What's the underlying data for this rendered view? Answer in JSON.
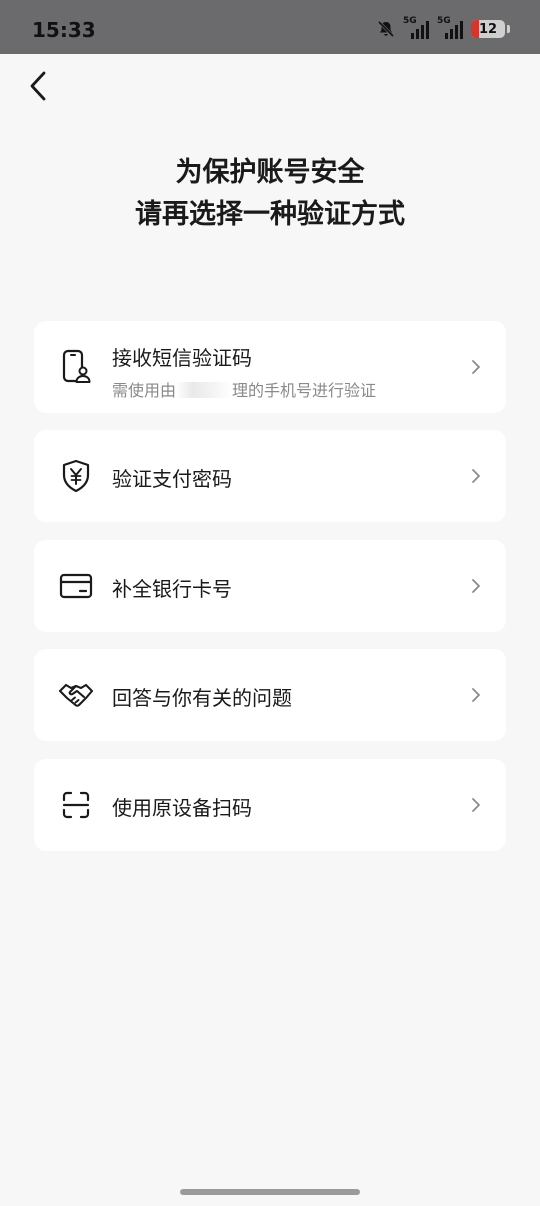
{
  "status_bar": {
    "time": "15:33",
    "signal_1_label": "5G",
    "signal_2_label": "5G",
    "battery_level": "12"
  },
  "header": {
    "back_icon": "chevron-left-icon"
  },
  "title": {
    "line1": "为保护账号安全",
    "line2": "请再选择一种验证方式"
  },
  "options": [
    {
      "icon": "phone-user-icon",
      "label": "接收短信验证码",
      "sub": "需使用由",
      "sub_tail": "理的手机号进行验证"
    },
    {
      "icon": "yuan-shield-icon",
      "label": "验证支付密码"
    },
    {
      "icon": "bank-card-icon",
      "label": "补全银行卡号"
    },
    {
      "icon": "handshake-icon",
      "label": "回答与你有关的问题"
    },
    {
      "icon": "scan-icon",
      "label": "使用原设备扫码"
    }
  ],
  "colors": {
    "background": "#f7f7f7",
    "card": "#ffffff",
    "status_bar": "#6b6b6e",
    "text_primary": "#1a1a1a",
    "text_secondary": "#8a8a8a",
    "battery_low": "#d9342b"
  }
}
